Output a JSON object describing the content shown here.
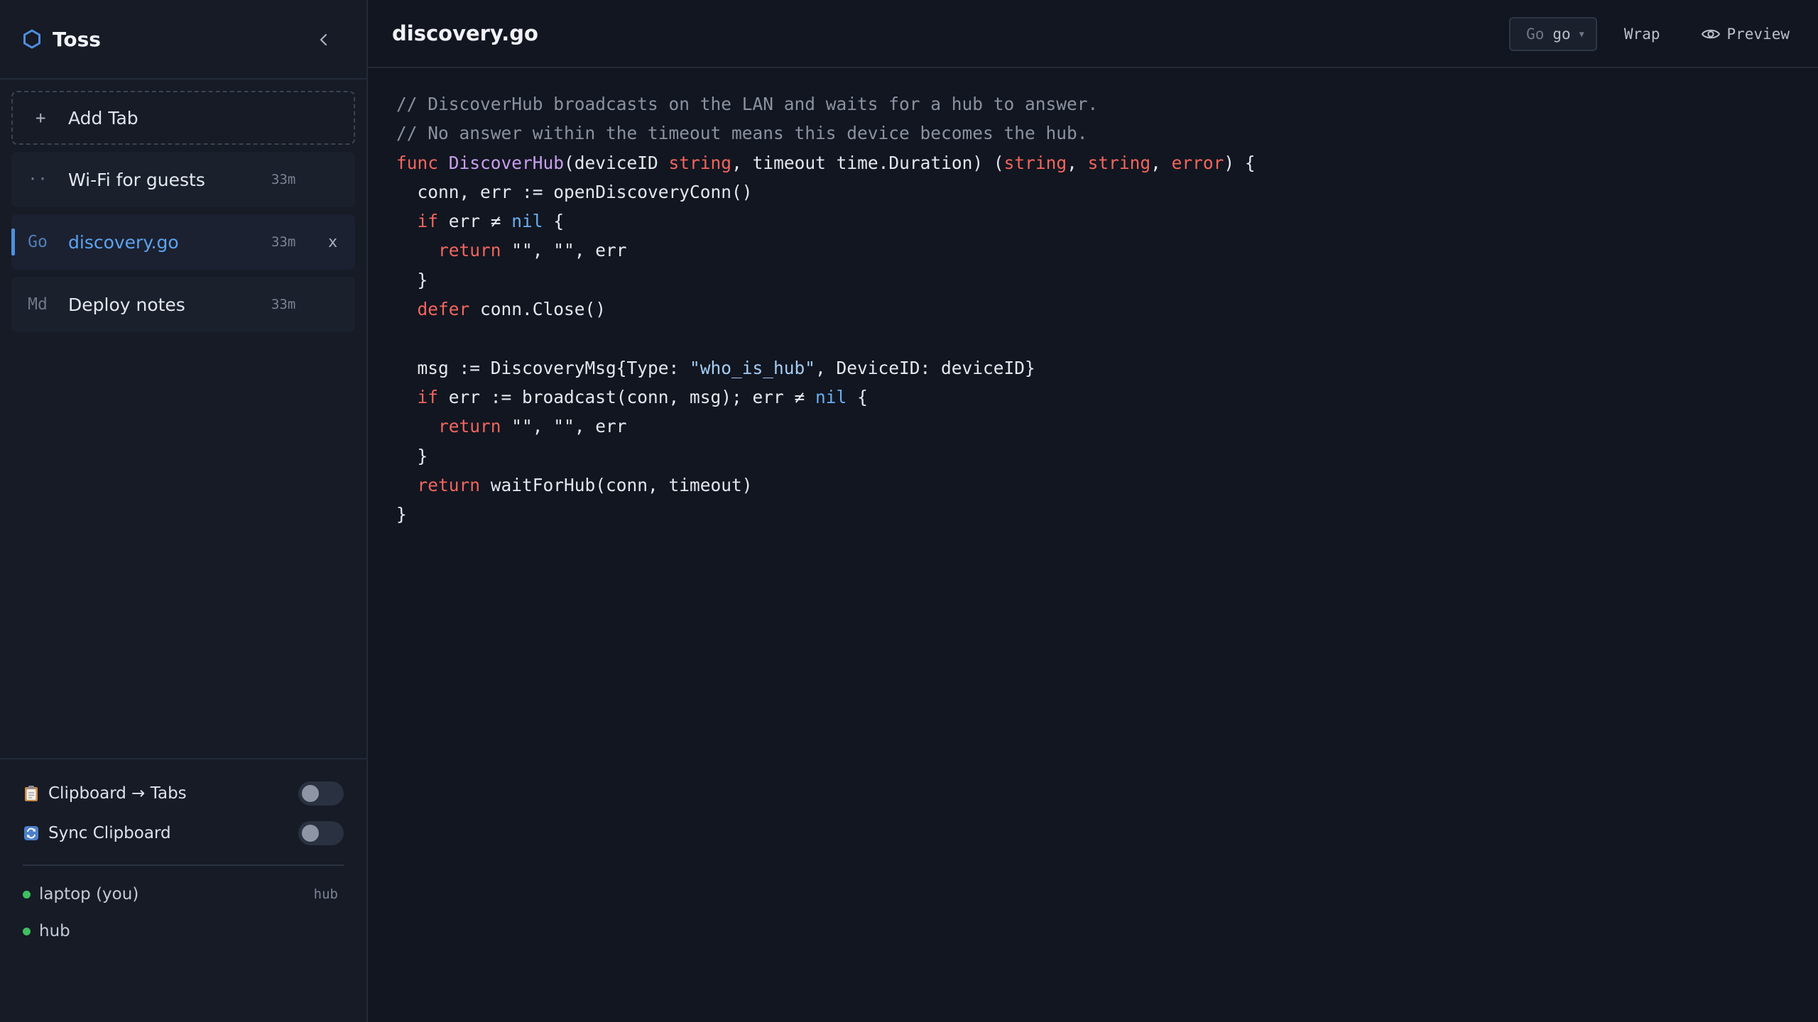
{
  "app": {
    "title": "Toss"
  },
  "sidebar": {
    "add_tab_label": "Add Tab",
    "add_tab_icon": "+",
    "tabs": [
      {
        "badge": "··",
        "name": "Wi-Fi for guests",
        "age": "33m",
        "active": false
      },
      {
        "badge": "Go",
        "name": "discovery.go",
        "age": "33m",
        "active": true,
        "close": "x"
      },
      {
        "badge": "Md",
        "name": "Deploy notes",
        "age": "33m",
        "active": false
      }
    ],
    "settings": [
      {
        "icon": "clipboard-icon",
        "label": "Clipboard → Tabs",
        "enabled": false
      },
      {
        "icon": "sync-icon",
        "label": "Sync Clipboard",
        "enabled": false
      }
    ],
    "devices": [
      {
        "label": "laptop (you)",
        "role": "hub",
        "status_color": "#3fbf5f"
      },
      {
        "label": "hub",
        "role": "",
        "status_color": "#3fbf5f"
      }
    ]
  },
  "editor": {
    "file_title": "discovery.go",
    "language_badge": "Go",
    "language_value": "go",
    "wrap_label": "Wrap",
    "preview_label": "Preview",
    "code_lines": [
      [
        {
          "t": "// DiscoverHub broadcasts on the LAN and waits for a hub to answer.",
          "c": "comment"
        }
      ],
      [
        {
          "t": "// No answer within the timeout means this device becomes the hub.",
          "c": "comment"
        }
      ],
      [
        {
          "t": "func ",
          "c": "kw"
        },
        {
          "t": "DiscoverHub",
          "c": "fn"
        },
        {
          "t": "(deviceID ",
          "c": "plain"
        },
        {
          "t": "string",
          "c": "type"
        },
        {
          "t": ", timeout time.Duration) (",
          "c": "plain"
        },
        {
          "t": "string",
          "c": "type"
        },
        {
          "t": ", ",
          "c": "plain"
        },
        {
          "t": "string",
          "c": "type"
        },
        {
          "t": ", ",
          "c": "plain"
        },
        {
          "t": "error",
          "c": "type"
        },
        {
          "t": ") {",
          "c": "plain"
        }
      ],
      [
        {
          "t": "  conn, err := openDiscoveryConn()",
          "c": "plain"
        }
      ],
      [
        {
          "t": "  ",
          "c": "plain"
        },
        {
          "t": "if",
          "c": "kw"
        },
        {
          "t": " err ≠ ",
          "c": "plain"
        },
        {
          "t": "nil",
          "c": "const"
        },
        {
          "t": " {",
          "c": "plain"
        }
      ],
      [
        {
          "t": "    ",
          "c": "plain"
        },
        {
          "t": "return",
          "c": "kw"
        },
        {
          "t": " \"\", \"\", err",
          "c": "plain"
        }
      ],
      [
        {
          "t": "  }",
          "c": "plain"
        }
      ],
      [
        {
          "t": "  ",
          "c": "plain"
        },
        {
          "t": "defer",
          "c": "kw"
        },
        {
          "t": " conn.Close()",
          "c": "plain"
        }
      ],
      [
        {
          "t": "",
          "c": "plain"
        }
      ],
      [
        {
          "t": "  msg := DiscoveryMsg{Type: ",
          "c": "plain"
        },
        {
          "t": "\"who_is_hub\"",
          "c": "str"
        },
        {
          "t": ", DeviceID: deviceID}",
          "c": "plain"
        }
      ],
      [
        {
          "t": "  ",
          "c": "plain"
        },
        {
          "t": "if",
          "c": "kw"
        },
        {
          "t": " err := broadcast(conn, msg); err ≠ ",
          "c": "plain"
        },
        {
          "t": "nil",
          "c": "const"
        },
        {
          "t": " {",
          "c": "plain"
        }
      ],
      [
        {
          "t": "    ",
          "c": "plain"
        },
        {
          "t": "return",
          "c": "kw"
        },
        {
          "t": " \"\", \"\", err",
          "c": "plain"
        }
      ],
      [
        {
          "t": "  }",
          "c": "plain"
        }
      ],
      [
        {
          "t": "  ",
          "c": "plain"
        },
        {
          "t": "return",
          "c": "kw"
        },
        {
          "t": " waitForHub(conn, timeout)",
          "c": "plain"
        }
      ],
      [
        {
          "t": "}",
          "c": "plain"
        }
      ]
    ]
  },
  "colors": {
    "accent": "#4f8fe0",
    "background": "#121620",
    "sidebar": "#161b26",
    "status_online": "#3fbf5f"
  }
}
